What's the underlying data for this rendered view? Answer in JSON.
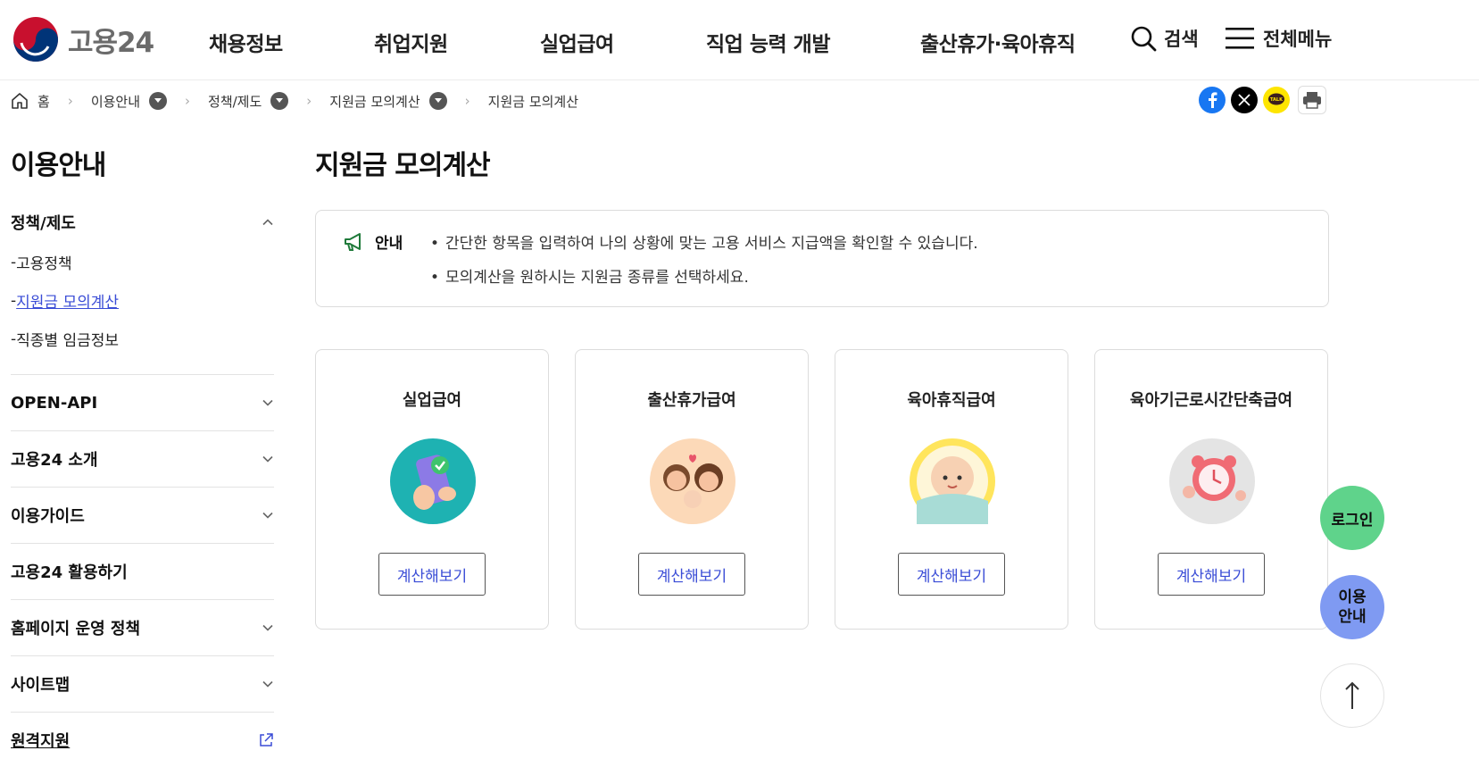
{
  "header": {
    "logo_text": "고용24",
    "nav": [
      "채용정보",
      "취업지원",
      "실업급여",
      "직업 능력 개발",
      "출산휴가·육아휴직"
    ],
    "search_label": "검색",
    "menu_label": "전체메뉴"
  },
  "breadcrumb": {
    "home": "홈",
    "items": [
      "이용안내",
      "정책/제도",
      "지원금 모의계산"
    ],
    "current": "지원금 모의계산"
  },
  "sidebar": {
    "title": "이용안내",
    "groups": [
      {
        "label": "정책/제도",
        "children": [
          "고용정책",
          "지원금 모의계산",
          "직종별 임금정보"
        ],
        "active_child": "지원금 모의계산"
      },
      {
        "label": "OPEN-API"
      },
      {
        "label": "고용24 소개"
      },
      {
        "label": "이용가이드"
      },
      {
        "label": "고용24 활용하기"
      },
      {
        "label": "홈페이지 운영 정책"
      },
      {
        "label": "사이트맵"
      },
      {
        "label": "원격지원"
      }
    ]
  },
  "main": {
    "page_title": "지원금 모의계산",
    "notice": {
      "label": "안내",
      "items": [
        "간단한 항목을 입력하여 나의 상황에 맞는 고용 서비스 지급액을 확인할 수 있습니다.",
        "모의계산을 원하시는 지원금 종류를 선택하세요."
      ]
    },
    "cards": [
      {
        "title": "실업급여",
        "button": "계산해보기",
        "icon": "phone-check-icon"
      },
      {
        "title": "출산휴가급여",
        "button": "계산해보기",
        "icon": "family-icon"
      },
      {
        "title": "육아휴직급여",
        "button": "계산해보기",
        "icon": "baby-icon"
      },
      {
        "title": "육아기근로시간단축급여",
        "button": "계산해보기",
        "icon": "alarm-clock-icon"
      }
    ]
  },
  "floating": {
    "login": "로그인",
    "guide": "이용 안내"
  },
  "colors": {
    "accent_blue": "#3a4cd6",
    "login_green": "#5fd38b",
    "guide_blue": "#7f9af2",
    "facebook": "#1877f2",
    "kakao": "#fee500"
  }
}
